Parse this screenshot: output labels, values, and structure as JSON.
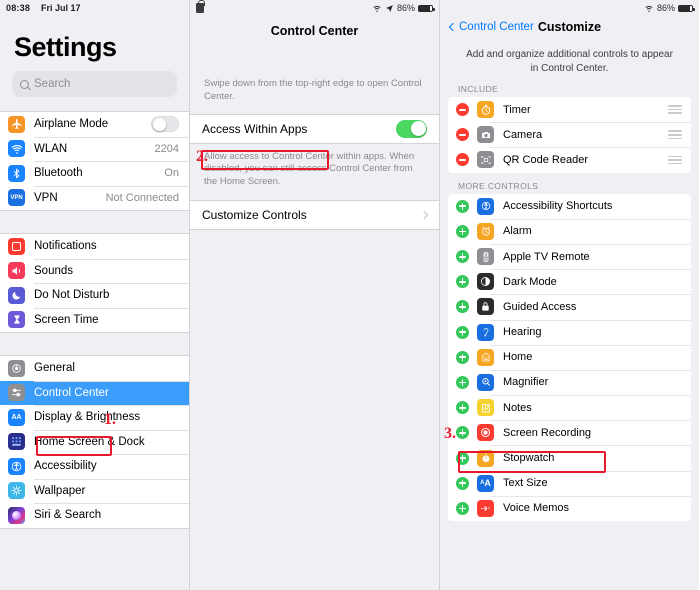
{
  "sidebar": {
    "status": {
      "time": "08:38",
      "date": "Fri Jul 17"
    },
    "title": "Settings",
    "search": {
      "placeholder": "Search",
      "icon": "search-icon"
    },
    "groups": [
      {
        "items": [
          {
            "label": "Airplane Mode",
            "icon": "airplane-icon",
            "control": "toggle-off",
            "value": ""
          },
          {
            "label": "WLAN",
            "icon": "wifi-icon",
            "control": "value",
            "value": "2204"
          },
          {
            "label": "Bluetooth",
            "icon": "bluetooth-icon",
            "control": "value",
            "value": "On"
          },
          {
            "label": "VPN",
            "icon": "vpn-icon",
            "control": "value",
            "value": "Not Connected"
          }
        ]
      },
      {
        "items": [
          {
            "label": "Notifications",
            "icon": "notifications-icon",
            "control": "none",
            "value": ""
          },
          {
            "label": "Sounds",
            "icon": "sounds-icon",
            "control": "none",
            "value": ""
          },
          {
            "label": "Do Not Disturb",
            "icon": "do-not-disturb-icon",
            "control": "none",
            "value": ""
          },
          {
            "label": "Screen Time",
            "icon": "screen-time-icon",
            "control": "none",
            "value": ""
          }
        ]
      },
      {
        "items": [
          {
            "label": "General",
            "icon": "general-icon",
            "control": "none",
            "value": ""
          },
          {
            "label": "Control Center",
            "icon": "control-center-icon",
            "control": "none",
            "value": "",
            "selected": true
          },
          {
            "label": "Display & Brightness",
            "icon": "display-brightness-icon",
            "control": "none",
            "value": ""
          },
          {
            "label": "Home Screen & Dock",
            "icon": "home-screen-dock-icon",
            "control": "none",
            "value": ""
          },
          {
            "label": "Accessibility",
            "icon": "accessibility-icon",
            "control": "none",
            "value": ""
          },
          {
            "label": "Wallpaper",
            "icon": "wallpaper-icon",
            "control": "none",
            "value": ""
          },
          {
            "label": "Siri & Search",
            "icon": "siri-search-icon",
            "control": "none",
            "value": ""
          }
        ]
      }
    ]
  },
  "middle": {
    "status": {
      "battery_percent": "86%"
    },
    "title": "Control Center",
    "hint_top": "Swipe down from the top-right edge to open Control Center.",
    "access_row": {
      "label": "Access Within Apps",
      "toggle": "on"
    },
    "hint_bottom": "Allow access to Control Center within apps. When disabled, you can still access Control Center from the Home Screen.",
    "customize_row": {
      "label": "Customize Controls"
    }
  },
  "right": {
    "status": {
      "battery_percent": "86%"
    },
    "back_label": "Control Center",
    "title": "Customize",
    "intro": "Add and organize additional controls to appear in Control Center.",
    "include_header": "INCLUDE",
    "more_header": "MORE CONTROLS",
    "include": [
      {
        "label": "Timer",
        "icon": "timer-icon",
        "action": "remove"
      },
      {
        "label": "Camera",
        "icon": "camera-icon",
        "action": "remove"
      },
      {
        "label": "QR Code Reader",
        "icon": "qr-code-reader-icon",
        "action": "remove"
      }
    ],
    "more": [
      {
        "label": "Accessibility Shortcuts",
        "icon": "accessibility-shortcuts-icon",
        "action": "add"
      },
      {
        "label": "Alarm",
        "icon": "alarm-icon",
        "action": "add"
      },
      {
        "label": "Apple TV Remote",
        "icon": "apple-tv-remote-icon",
        "action": "add"
      },
      {
        "label": "Dark Mode",
        "icon": "dark-mode-icon",
        "action": "add"
      },
      {
        "label": "Guided Access",
        "icon": "guided-access-icon",
        "action": "add"
      },
      {
        "label": "Hearing",
        "icon": "hearing-icon",
        "action": "add"
      },
      {
        "label": "Home",
        "icon": "home-icon",
        "action": "add"
      },
      {
        "label": "Magnifier",
        "icon": "magnifier-icon",
        "action": "add"
      },
      {
        "label": "Notes",
        "icon": "notes-icon",
        "action": "add"
      },
      {
        "label": "Screen Recording",
        "icon": "screen-recording-icon",
        "action": "add",
        "highlighted": true
      },
      {
        "label": "Stopwatch",
        "icon": "stopwatch-icon",
        "action": "add"
      },
      {
        "label": "Text Size",
        "icon": "text-size-icon",
        "action": "add"
      },
      {
        "label": "Voice Memos",
        "icon": "voice-memos-icon",
        "action": "add"
      }
    ]
  },
  "annotations": {
    "accent": "#e8192c",
    "steps": [
      {
        "number": "1."
      },
      {
        "number": "2."
      },
      {
        "number": "3."
      }
    ]
  }
}
